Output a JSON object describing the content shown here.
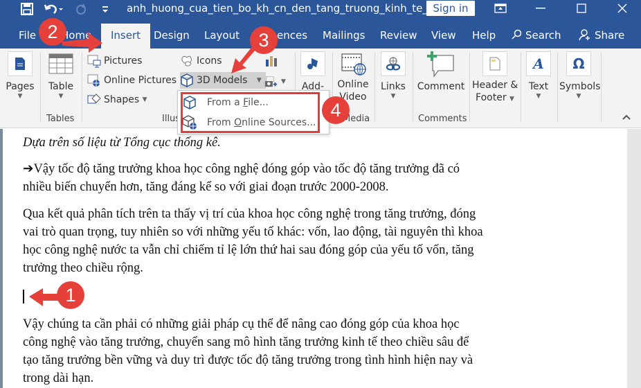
{
  "titlebar": {
    "quick_access": [
      {
        "name": "save-icon",
        "glyph": "💾"
      },
      {
        "name": "undo-icon",
        "glyph": "↶"
      },
      {
        "name": "redo-icon",
        "glyph": "↻"
      },
      {
        "name": "customize-qat-icon",
        "glyph": "≡"
      }
    ],
    "document_title": "anh_huong_cua_tien_bo_kh_cn_den_tang_truong_kinh_te_viet_...",
    "sign_in_label": "Sign in",
    "ribbon_display_glyph": "⊡",
    "minimize_glyph": "—",
    "maximize_glyph": "☐",
    "close_glyph": "✕"
  },
  "tabs": {
    "items": [
      "File",
      "Home",
      "Insert",
      "Design",
      "Layout",
      "References",
      "Mailings",
      "Review",
      "View",
      "Help"
    ],
    "visible_labels": {
      "file": "File",
      "home": "Home",
      "insert": "Insert",
      "design": "Design",
      "layout": "Layout",
      "references": "ences",
      "mailings": "Mailings",
      "review": "Review",
      "view": "View",
      "help": "Help"
    },
    "active": "Insert",
    "search_label": "Search",
    "share_label": "Share"
  },
  "ribbon": {
    "pages": {
      "label": "Pages"
    },
    "tables": {
      "table_label": "Table",
      "group_label": "Tables"
    },
    "illustrations": {
      "pictures": "Pictures",
      "online_pictures": "Online Pictures",
      "shapes": "Shapes",
      "icons": "Icons",
      "models_3d": "3D Models",
      "group_label": "Illus"
    },
    "addins": {
      "label": "Add-"
    },
    "media": {
      "label_line1": "Online",
      "label_line2": "Video",
      "group_label": "Media"
    },
    "links": {
      "label": "Links"
    },
    "comments": {
      "comment_label": "Comment",
      "group_label": "Comments"
    },
    "header_footer": {
      "line1": "Header &",
      "line2": "Footer"
    },
    "text": {
      "label": "Text"
    },
    "symbols": {
      "label": "Symbols"
    }
  },
  "dropdown_3d_models": {
    "items": [
      {
        "label_pre": "From a ",
        "label_ul": "F",
        "label_post": "ile..."
      },
      {
        "label_pre": "From ",
        "label_ul": "O",
        "label_post": "nline Sources..."
      }
    ]
  },
  "document": {
    "lines": [
      "Dựa trên số liệu từ Tổng cục thống kê.",
      "➔Vậy tốc độ tăng trưởng khoa học công nghệ đóng góp vào tốc độ tăng trưởng đã có",
      "nhiều biến chuyển hơn, tăng đáng kể so với giai đoạn trước 2000-2008.",
      "Qua kết quả phân tích trên ta thấy vị trí của khoa học công nghệ trong tăng trưởng, đóng",
      "vai trò quan trọng, tuy nhiên so với những yếu tố khác: vốn, lao động, tài nguyên thì khoa",
      "học công nghệ nước ta vẫn chỉ chiếm tỉ lệ lớn thứ hai sau đóng góp của yếu tố vốn, tăng",
      "trưởng theo chiều rộng.",
      " Vậy chúng ta cần phải có những giải pháp cụ thể để nâng cao đóng góp của khoa học",
      "công nghệ vào tăng trưởng, chuyển sang mô hình tăng trưởng kinh tế theo chiều sâu để",
      "tạo tăng trưởng bền vững và duy trì được tốc độ tăng trưởng trong tình hình hiện nay và",
      "trong dài hạn."
    ]
  },
  "annotations": {
    "markers": [
      "1",
      "2",
      "3",
      "4"
    ],
    "color": "#e5403a"
  },
  "colors": {
    "titlebar": "#2b579a",
    "ribbon": "#f3f3f3",
    "highlight_box": "#e03c3c"
  }
}
